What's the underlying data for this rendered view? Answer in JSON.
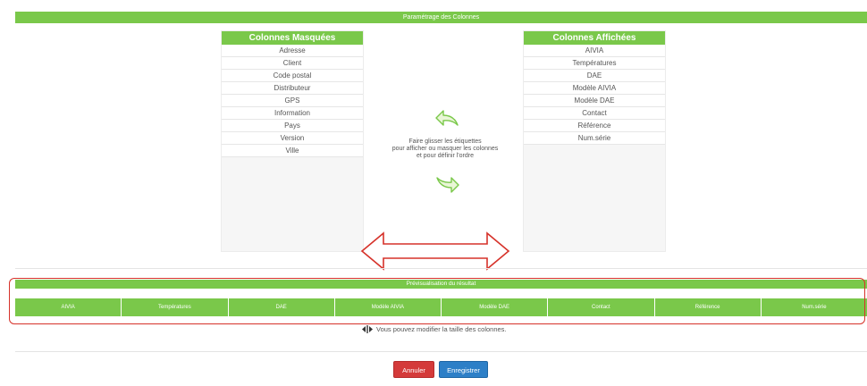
{
  "header": {
    "title": "Paramétrage des Colonnes"
  },
  "hidden_columns": {
    "title": "Colonnes Masquées",
    "items": [
      "Adresse",
      "Client",
      "Code postal",
      "Distributeur",
      "GPS",
      "Information",
      "Pays",
      "Version",
      "Ville"
    ]
  },
  "shown_columns": {
    "title": "Colonnes Affichées",
    "items": [
      "AIVIA",
      "Températures",
      "DAE",
      "Modèle AIVIA",
      "Modèle DAE",
      "Contact",
      "Référence",
      "Num.série"
    ]
  },
  "instructions": {
    "line1": "Faire glisser les étiquettes",
    "line2": "pour afficher ou masquer les colonnes",
    "line3": "et pour définir l'ordre"
  },
  "preview": {
    "title": "Prévisualisation du résultat",
    "columns": [
      "AIVIA",
      "Températures",
      "DAE",
      "Modèle AIVIA",
      "Modèle DAE",
      "Contact",
      "Référence",
      "Num.série"
    ]
  },
  "resize_hint": "Vous pouvez modifier la taille des colonnes.",
  "buttons": {
    "cancel": "Annuler",
    "save": "Enregistrer"
  },
  "colors": {
    "accent_green": "#7ac84a",
    "cancel_red": "#d43a3a",
    "save_blue": "#2d7fc7",
    "annotation_red": "#d6322a"
  }
}
